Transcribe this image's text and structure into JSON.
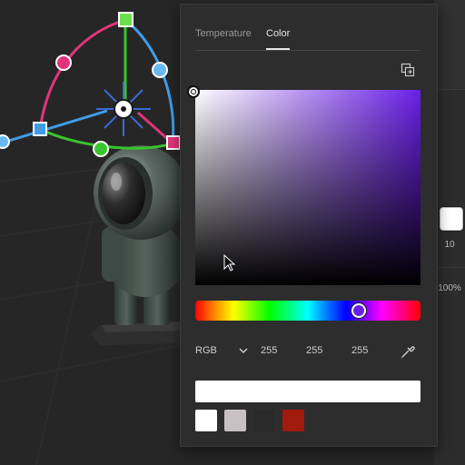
{
  "popover": {
    "tabs": [
      {
        "label": "Temperature",
        "active": false
      },
      {
        "label": "Color",
        "active": true
      }
    ],
    "mode_toggle_icon": "color-mode-toggle-icon",
    "picker": {
      "hue_color": "#6a1fe6",
      "saturation": 0,
      "brightness": 1,
      "hue_position": 0.74
    },
    "format": {
      "selected": "RGB",
      "channels": [
        "255",
        "255",
        "255"
      ]
    },
    "eyedropper_icon": "eyedropper-icon",
    "hex_value": "",
    "current_color": "#ffffff",
    "swatches": [
      "#ffffff",
      "#c9c0c3",
      "#2a2a2a",
      "#a11a0e"
    ]
  },
  "right_dock": {
    "color_swatch": "#ffffff",
    "value_a": "10",
    "value_b": "100%"
  },
  "gizmo": {
    "colors": {
      "x": "#3f9de8",
      "y": "#39c52b",
      "z": "#e0357a"
    }
  }
}
